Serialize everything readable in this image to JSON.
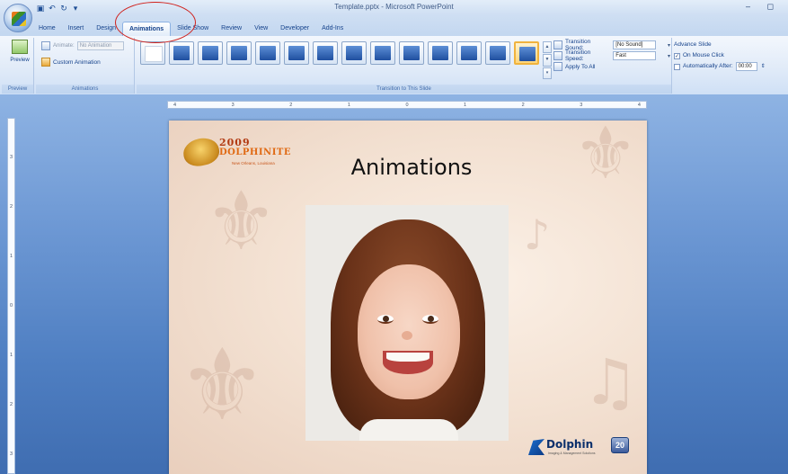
{
  "window": {
    "title": "Template.pptx - Microsoft PowerPoint",
    "controls": "– ◻"
  },
  "quick_access": {
    "icons": [
      "save-icon",
      "undo-icon",
      "redo-icon",
      "customize-icon"
    ],
    "glyphs": [
      "▣",
      "↶",
      "↻",
      "▾"
    ]
  },
  "tabs": [
    {
      "label": "Home",
      "active": false
    },
    {
      "label": "Insert",
      "active": false
    },
    {
      "label": "Design",
      "active": false
    },
    {
      "label": "Animations",
      "active": true
    },
    {
      "label": "Slide Show",
      "active": false
    },
    {
      "label": "Review",
      "active": false
    },
    {
      "label": "View",
      "active": false
    },
    {
      "label": "Developer",
      "active": false
    },
    {
      "label": "Add-Ins",
      "active": false
    }
  ],
  "ribbon": {
    "preview_group": {
      "button_label": "Preview",
      "group_label": "Preview"
    },
    "animations_group": {
      "animate_label": "Animate:",
      "animate_value": "No Animation",
      "custom_animation_label": "Custom Animation",
      "group_label": "Animations"
    },
    "transition_group": {
      "group_label": "Transition to This Slide",
      "thumbnail_count_note": "",
      "sound_label": "Transition Sound:",
      "sound_value": "[No Sound]",
      "speed_label": "Transition Speed:",
      "speed_value": "Fast",
      "apply_all_label": "Apply To All"
    },
    "advance_group": {
      "header": "Advance Slide",
      "on_click_label": "On Mouse Click",
      "on_click_checked": true,
      "auto_label": "Automatically After:",
      "auto_checked": false,
      "auto_value": "00:00"
    }
  },
  "ruler": {
    "h_labels": [
      "4",
      "3",
      "2",
      "1",
      "0",
      "1",
      "2",
      "3",
      "4"
    ],
    "v_labels": [
      "3",
      "2",
      "1",
      "0",
      "1",
      "2",
      "3"
    ]
  },
  "slide": {
    "title": "Animations",
    "event_logo": {
      "line1": "2009",
      "line2": "DOLPHINITE",
      "line3": "New Orleans, Louisiana"
    },
    "dolphin_logo": {
      "word": "Dolphin",
      "tagline": "Imaging & Management Solutions",
      "badge": "20"
    }
  },
  "colors": {
    "ribbon_text": "#15428b",
    "highlight_circle": "#d0201b",
    "workspace": "#6d98d4"
  }
}
